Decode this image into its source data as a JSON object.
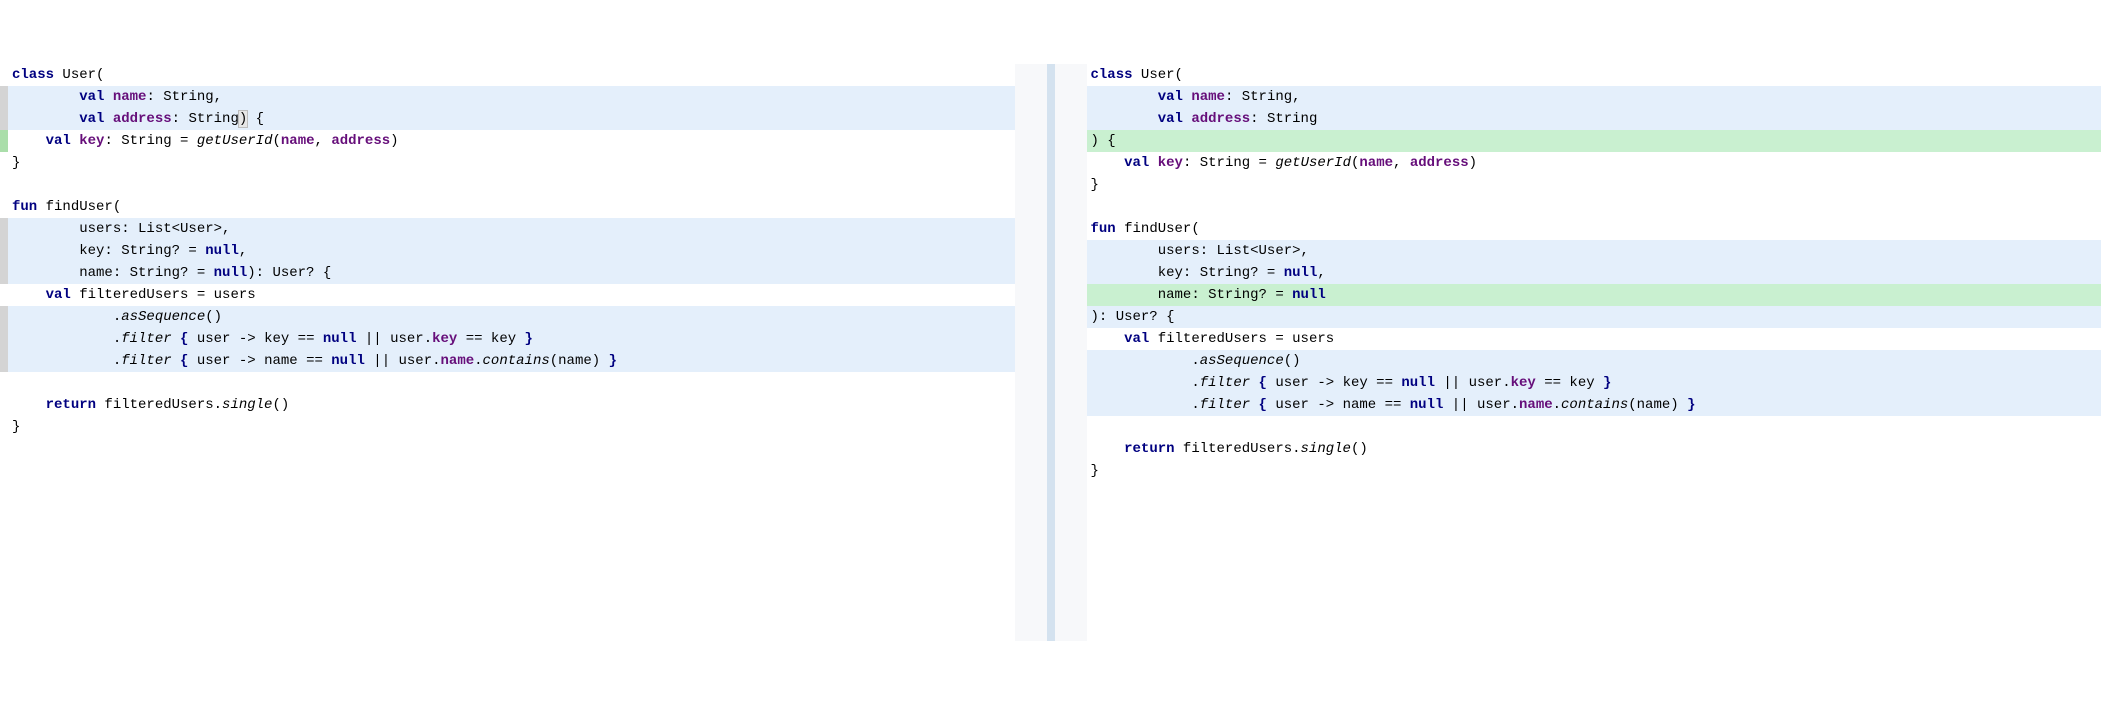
{
  "left": {
    "lines": [
      {
        "bg": "",
        "marker": "",
        "tokens": [
          {
            "t": "class ",
            "c": "kw"
          },
          {
            "t": "User(",
            "c": "ident"
          }
        ]
      },
      {
        "bg": "bg-mod",
        "marker": "marker-mod",
        "tokens": [
          {
            "t": "        ",
            "c": ""
          },
          {
            "t": "val ",
            "c": "kw"
          },
          {
            "t": "name",
            "c": "prop"
          },
          {
            "t": ": String,",
            "c": "ident"
          }
        ]
      },
      {
        "bg": "bg-mod",
        "marker": "marker-mod",
        "tokens": [
          {
            "t": "        ",
            "c": ""
          },
          {
            "t": "val ",
            "c": "kw"
          },
          {
            "t": "address",
            "c": "prop"
          },
          {
            "t": ": String",
            "c": "ident"
          },
          {
            "t": ")",
            "c": "caret-hl"
          },
          {
            "t": " {",
            "c": "ident"
          }
        ]
      },
      {
        "bg": "",
        "marker": "marker-add-line",
        "tokens": [
          {
            "t": "    ",
            "c": ""
          },
          {
            "t": "val ",
            "c": "kw"
          },
          {
            "t": "key",
            "c": "prop"
          },
          {
            "t": ": String = ",
            "c": "ident"
          },
          {
            "t": "getUserId",
            "c": "func"
          },
          {
            "t": "(",
            "c": "ident"
          },
          {
            "t": "name",
            "c": "prop"
          },
          {
            "t": ", ",
            "c": "ident"
          },
          {
            "t": "address",
            "c": "prop"
          },
          {
            "t": ")",
            "c": "ident"
          }
        ]
      },
      {
        "bg": "",
        "marker": "",
        "tokens": [
          {
            "t": "}",
            "c": "ident"
          }
        ]
      },
      {
        "bg": "",
        "marker": "",
        "tokens": [
          {
            "t": "",
            "c": ""
          }
        ]
      },
      {
        "bg": "",
        "marker": "",
        "tokens": [
          {
            "t": "fun ",
            "c": "kw"
          },
          {
            "t": "findUser(",
            "c": "ident"
          }
        ]
      },
      {
        "bg": "bg-mod",
        "marker": "marker-mod",
        "tokens": [
          {
            "t": "        users: List<User>,",
            "c": "ident"
          }
        ]
      },
      {
        "bg": "bg-mod",
        "marker": "marker-mod",
        "tokens": [
          {
            "t": "        key: String? = ",
            "c": "ident"
          },
          {
            "t": "null",
            "c": "kw"
          },
          {
            "t": ",",
            "c": "ident"
          }
        ]
      },
      {
        "bg": "bg-mod",
        "marker": "marker-mod",
        "tokens": [
          {
            "t": "        name: String? = ",
            "c": "ident"
          },
          {
            "t": "null",
            "c": "kw"
          },
          {
            "t": "): User? {",
            "c": "ident"
          }
        ]
      },
      {
        "bg": "",
        "marker": "",
        "tokens": [
          {
            "t": "    ",
            "c": ""
          },
          {
            "t": "val ",
            "c": "kw"
          },
          {
            "t": "filteredUsers = users",
            "c": "ident"
          }
        ]
      },
      {
        "bg": "bg-mod",
        "marker": "marker-mod",
        "tokens": [
          {
            "t": "            .",
            "c": "ident"
          },
          {
            "t": "asSequence",
            "c": "func"
          },
          {
            "t": "()",
            "c": "ident"
          }
        ]
      },
      {
        "bg": "bg-mod",
        "marker": "marker-mod",
        "tokens": [
          {
            "t": "            .",
            "c": "ident"
          },
          {
            "t": "filter",
            "c": "func"
          },
          {
            "t": " ",
            "c": ""
          },
          {
            "t": "{",
            "c": "kw"
          },
          {
            "t": " user -> key == ",
            "c": "ident"
          },
          {
            "t": "null",
            "c": "kw"
          },
          {
            "t": " || user.",
            "c": "ident"
          },
          {
            "t": "key",
            "c": "prop"
          },
          {
            "t": " == key ",
            "c": "ident"
          },
          {
            "t": "}",
            "c": "kw"
          }
        ]
      },
      {
        "bg": "bg-mod",
        "marker": "marker-mod",
        "tokens": [
          {
            "t": "            .",
            "c": "ident"
          },
          {
            "t": "filter",
            "c": "func"
          },
          {
            "t": " ",
            "c": ""
          },
          {
            "t": "{",
            "c": "kw"
          },
          {
            "t": " user -> name == ",
            "c": "ident"
          },
          {
            "t": "null",
            "c": "kw"
          },
          {
            "t": " || user.",
            "c": "ident"
          },
          {
            "t": "name",
            "c": "prop"
          },
          {
            "t": ".",
            "c": "ident"
          },
          {
            "t": "contains",
            "c": "func"
          },
          {
            "t": "(name) ",
            "c": "ident"
          },
          {
            "t": "}",
            "c": "kw"
          }
        ]
      },
      {
        "bg": "",
        "marker": "",
        "tokens": [
          {
            "t": "",
            "c": ""
          }
        ]
      },
      {
        "bg": "",
        "marker": "",
        "tokens": [
          {
            "t": "    ",
            "c": ""
          },
          {
            "t": "return ",
            "c": "kw"
          },
          {
            "t": "filteredUsers.",
            "c": "ident"
          },
          {
            "t": "single",
            "c": "func"
          },
          {
            "t": "()",
            "c": "ident"
          }
        ]
      },
      {
        "bg": "",
        "marker": "",
        "tokens": [
          {
            "t": "}",
            "c": "ident"
          }
        ]
      }
    ]
  },
  "right": {
    "lines": [
      {
        "bg": "",
        "marker": "",
        "tokens": [
          {
            "t": "class ",
            "c": "kw"
          },
          {
            "t": "User(",
            "c": "ident"
          }
        ]
      },
      {
        "bg": "bg-mod",
        "marker": "",
        "tokens": [
          {
            "t": "        ",
            "c": ""
          },
          {
            "t": "val ",
            "c": "kw"
          },
          {
            "t": "name",
            "c": "prop"
          },
          {
            "t": ": String,",
            "c": "ident"
          }
        ]
      },
      {
        "bg": "bg-mod",
        "marker": "",
        "tokens": [
          {
            "t": "        ",
            "c": ""
          },
          {
            "t": "val ",
            "c": "kw"
          },
          {
            "t": "address",
            "c": "prop"
          },
          {
            "t": ": String",
            "c": "ident"
          }
        ]
      },
      {
        "bg": "bg-add",
        "marker": "",
        "tokens": [
          {
            "t": ") {",
            "c": "ident"
          }
        ]
      },
      {
        "bg": "",
        "marker": "",
        "tokens": [
          {
            "t": "    ",
            "c": ""
          },
          {
            "t": "val ",
            "c": "kw"
          },
          {
            "t": "key",
            "c": "prop"
          },
          {
            "t": ": String = ",
            "c": "ident"
          },
          {
            "t": "getUserId",
            "c": "func"
          },
          {
            "t": "(",
            "c": "ident"
          },
          {
            "t": "name",
            "c": "prop"
          },
          {
            "t": ", ",
            "c": "ident"
          },
          {
            "t": "address",
            "c": "prop"
          },
          {
            "t": ")",
            "c": "ident"
          }
        ]
      },
      {
        "bg": "",
        "marker": "",
        "tokens": [
          {
            "t": "}",
            "c": "ident"
          }
        ]
      },
      {
        "bg": "",
        "marker": "",
        "tokens": [
          {
            "t": "",
            "c": ""
          }
        ]
      },
      {
        "bg": "",
        "marker": "",
        "tokens": [
          {
            "t": "fun ",
            "c": "kw"
          },
          {
            "t": "findUser(",
            "c": "ident"
          }
        ]
      },
      {
        "bg": "bg-mod",
        "marker": "",
        "tokens": [
          {
            "t": "        users: List<User>,",
            "c": "ident"
          }
        ]
      },
      {
        "bg": "bg-mod",
        "marker": "",
        "tokens": [
          {
            "t": "        key: String? = ",
            "c": "ident"
          },
          {
            "t": "null",
            "c": "kw"
          },
          {
            "t": ",",
            "c": "ident"
          }
        ]
      },
      {
        "bg": "bg-add",
        "marker": "",
        "tokens": [
          {
            "t": "        name: String? = ",
            "c": "ident"
          },
          {
            "t": "null",
            "c": "kw"
          }
        ]
      },
      {
        "bg": "bg-mod",
        "marker": "",
        "tokens": [
          {
            "t": "): User? {",
            "c": "ident"
          }
        ]
      },
      {
        "bg": "",
        "marker": "",
        "tokens": [
          {
            "t": "    ",
            "c": ""
          },
          {
            "t": "val ",
            "c": "kw"
          },
          {
            "t": "filteredUsers = users",
            "c": "ident"
          }
        ]
      },
      {
        "bg": "bg-mod",
        "marker": "",
        "tokens": [
          {
            "t": "            .",
            "c": "ident"
          },
          {
            "t": "asSequence",
            "c": "func"
          },
          {
            "t": "()",
            "c": "ident"
          }
        ]
      },
      {
        "bg": "bg-mod",
        "marker": "",
        "tokens": [
          {
            "t": "            .",
            "c": "ident"
          },
          {
            "t": "filter",
            "c": "func"
          },
          {
            "t": " ",
            "c": ""
          },
          {
            "t": "{",
            "c": "kw"
          },
          {
            "t": " user -> key == ",
            "c": "ident"
          },
          {
            "t": "null",
            "c": "kw"
          },
          {
            "t": " || user.",
            "c": "ident"
          },
          {
            "t": "key",
            "c": "prop"
          },
          {
            "t": " == key ",
            "c": "ident"
          },
          {
            "t": "}",
            "c": "kw"
          }
        ]
      },
      {
        "bg": "bg-mod",
        "marker": "",
        "tokens": [
          {
            "t": "            .",
            "c": "ident"
          },
          {
            "t": "filter",
            "c": "func"
          },
          {
            "t": " ",
            "c": ""
          },
          {
            "t": "{",
            "c": "kw"
          },
          {
            "t": " user -> name == ",
            "c": "ident"
          },
          {
            "t": "null",
            "c": "kw"
          },
          {
            "t": " || user.",
            "c": "ident"
          },
          {
            "t": "name",
            "c": "prop"
          },
          {
            "t": ".",
            "c": "ident"
          },
          {
            "t": "contains",
            "c": "func"
          },
          {
            "t": "(name) ",
            "c": "ident"
          },
          {
            "t": "}",
            "c": "kw"
          }
        ]
      },
      {
        "bg": "",
        "marker": "",
        "tokens": [
          {
            "t": "",
            "c": ""
          }
        ]
      },
      {
        "bg": "",
        "marker": "",
        "tokens": [
          {
            "t": "    ",
            "c": ""
          },
          {
            "t": "return ",
            "c": "kw"
          },
          {
            "t": "filteredUsers.",
            "c": "ident"
          },
          {
            "t": "single",
            "c": "func"
          },
          {
            "t": "()",
            "c": "ident"
          }
        ]
      },
      {
        "bg": "",
        "marker": "",
        "tokens": [
          {
            "t": "}",
            "c": "ident"
          }
        ]
      }
    ]
  }
}
